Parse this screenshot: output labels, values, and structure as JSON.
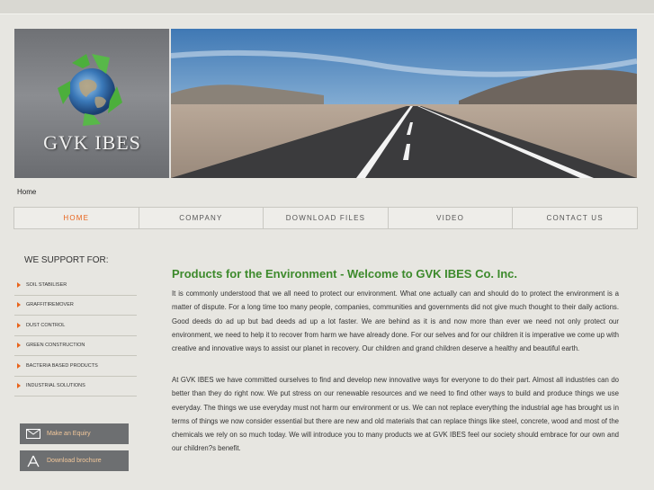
{
  "logo": {
    "text": "GVK IBES"
  },
  "breadcrumb": "Home",
  "nav": {
    "items": [
      {
        "label": "HOME",
        "active": true
      },
      {
        "label": "COMPANY",
        "active": false
      },
      {
        "label": "DOWNLOAD FILES",
        "active": false
      },
      {
        "label": "VIDEO",
        "active": false
      },
      {
        "label": "CONTACT US",
        "active": false
      }
    ]
  },
  "sidebar": {
    "title": "WE SUPPORT FOR:",
    "items": [
      {
        "label": "SOIL STABILISER"
      },
      {
        "label": "GRAFFITIREMOVER"
      },
      {
        "label": "DUST CONTROL"
      },
      {
        "label": "GREEN CONSTRUCTION"
      },
      {
        "label": "BACTERIA BASED PRODUCTS"
      },
      {
        "label": "INDUSTRIAL SOLUTIONS"
      }
    ],
    "enquiry_label": "Make an Equiry",
    "brochure_label": "Download brochure"
  },
  "main": {
    "title": "Products for the Environment - Welcome to GVK IBES Co. Inc.",
    "paragraphs": [
      "It is commonly understood that we all need to protect our environment. What one actually can and should do to protect the environment is a matter of dispute. For a long time too many people, companies, communities and governments did not give much thought to their daily actions. Good deeds do ad up but bad deeds ad up a lot faster. We are behind as it is and now more than ever we need not only protect our environment, we need to help it to recover from harm we have already done. For our selves and for our children it is imperative we come up with creative and innovative ways to assist our planet in recovery. Our children and grand children deserve a healthy and beautiful earth.",
      "At GVK IBES we have committed ourselves to find and develop new innovative ways for everyone to do their part. Almost all industries can do better than they do right now. We put stress on our renewable resources and we need to find other ways to build and produce things we use everyday. The things we use everyday must not harm our environment or us. We can not replace everything the industrial age has brought us in terms of things we now consider essential but there are new and old materials that can replace things like steel, concrete, wood and most of the chemicals we rely on so much today. We will introduce you to many products we at GVK IBES feel our society should embrace for our own and our children?s benefit."
    ]
  },
  "colors": {
    "accent": "#e8641c",
    "title_green": "#3d8a2c",
    "button_bg": "#6d6f71",
    "button_text": "#f2c79a"
  }
}
